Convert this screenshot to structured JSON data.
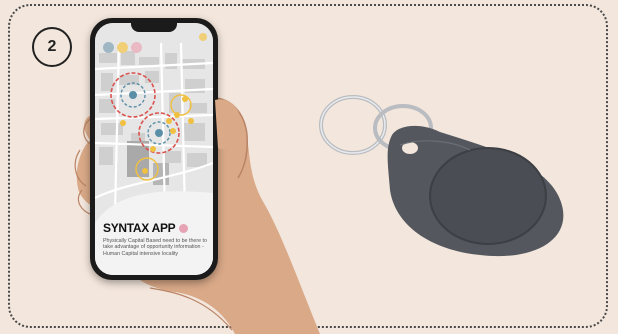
{
  "step": {
    "number": "2"
  },
  "app": {
    "title": "SYNTAX APP",
    "description": "Physically Capital Based need to be there to take advantage of opportunity information - Human Capital intensive locality"
  },
  "icons": {
    "toolbar": [
      "bird-icon",
      "star-icon",
      "home-icon"
    ],
    "title": "person-icon"
  },
  "colors": {
    "background": "#f3e6dc",
    "red_ring": "#d9534f",
    "blue_ring": "#5b8fa8",
    "yellow_ring": "#f0c040",
    "keyfob": "#54575e"
  }
}
